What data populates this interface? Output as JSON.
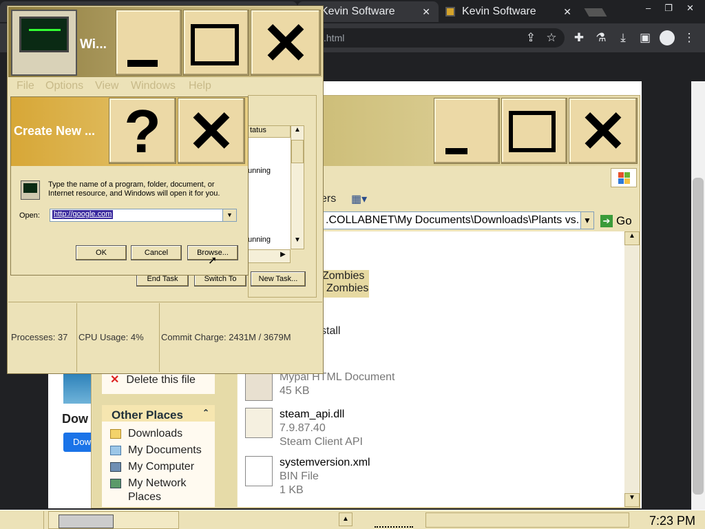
{
  "browser": {
    "tabs": [
      {
        "title": "Kevin Software"
      },
      {
        "title": "Kevin Software"
      }
    ],
    "address": ".html",
    "icons": [
      "share-icon",
      "star-icon",
      "extensions-icon",
      "lab-icon",
      "download-icon",
      "sidepanel-icon",
      "profile-icon",
      "menu-icon"
    ],
    "window_controls": {
      "minimize": "–",
      "maximize": "❐",
      "close": "✕"
    }
  },
  "explorer": {
    "title_buttons": {
      "minimize": "_",
      "maximize": "☐",
      "close": "✕"
    },
    "toolbar_partial": "ers",
    "address": ".COLLABNET\\My Documents\\Downloads\\Plants vs. Z",
    "go_label": "Go",
    "selected_partial": [
      "Zombies",
      "Zombies"
    ],
    "stall_partial": "stall",
    "left_pane": {
      "delete_label": "Delete this file",
      "other_places_header": "Other Places",
      "places": [
        "Downloads",
        "My Documents",
        "My Computer",
        "My Network Places"
      ]
    },
    "files": [
      {
        "name": "",
        "type": "Mypal HTML Document",
        "size": "45 KB"
      },
      {
        "name": "steam_api.dll",
        "type": "7.9.87.40",
        "size": "Steam Client API"
      },
      {
        "name": "systemversion.xml",
        "type": "BIN File",
        "size": "1 KB"
      }
    ],
    "bg_page_text": {
      "heading": "Dow",
      "button": "Dow"
    }
  },
  "taskmgr": {
    "title": "Wi...",
    "menu": [
      "File",
      "Options",
      "View",
      "Windows",
      "Help"
    ],
    "list_header": "tatus",
    "rows": [
      "unning",
      "unning"
    ],
    "buttons": {
      "end_task": "End Task",
      "switch_to": "Switch To",
      "new_task": "New Task..."
    },
    "status": {
      "processes": "Processes: 37",
      "cpu": "CPU Usage: 4%",
      "commit": "Commit Charge: 2431M / 3679M"
    }
  },
  "run": {
    "title": "Create New ...",
    "help": "?",
    "close": "✕",
    "description_line1": "Type the name of a program, folder, document, or",
    "description_line2": "Internet resource, and Windows will open it for you.",
    "open_label": "Open:",
    "open_value": "http://google.com",
    "ok": "OK",
    "cancel": "Cancel",
    "browse": "Browse..."
  },
  "taskbar": {
    "clock": "7:23 PM"
  }
}
